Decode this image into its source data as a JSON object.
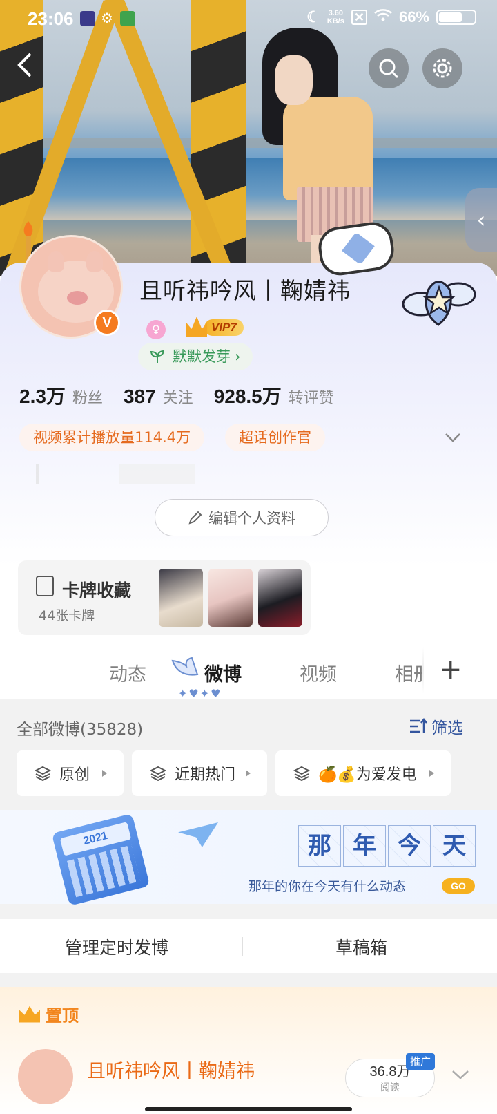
{
  "status_bar": {
    "time": "23:06",
    "net_speed_value": "3.60",
    "net_speed_unit": "KB/s",
    "battery": "66%",
    "battery_level_pct": 66
  },
  "nav": {
    "back_icon": "chevron-left-icon",
    "search_icon": "search-icon",
    "settings_icon": "gear-icon"
  },
  "profile": {
    "username": "且听祎吟风丨鞠婧祎",
    "vip_label": "VIP7",
    "verified_mark": "V",
    "sprout_label": "默默发芽",
    "sprout_arrow": "›",
    "stats": [
      {
        "value": "2.3万",
        "label": "粉丝"
      },
      {
        "value": "387",
        "label": "关注"
      },
      {
        "value": "928.5万",
        "label": "转评赞"
      }
    ],
    "tags": [
      "视频累计播放量114.4万",
      "超话创作官"
    ],
    "edit_button": "编辑个人资料"
  },
  "card_collection": {
    "title": "卡牌收藏",
    "count": "44张卡牌"
  },
  "tabs": {
    "items": [
      "动态",
      "微博",
      "视频",
      "相册"
    ],
    "active": "微博",
    "active_deco": "✦♥✦♥",
    "add": "+"
  },
  "feed": {
    "all_count": "全部微博(35828)",
    "filter_label": "筛选",
    "chips": [
      "原创",
      "近期热门",
      "🍊💰为爱发电"
    ],
    "on_this_day": {
      "chars": [
        "那",
        "年",
        "今",
        "天"
      ],
      "subtitle": "那年的你在今天有什么动态",
      "go": "GO",
      "calendar_year": "2021"
    },
    "manage_scheduled": "管理定时发博",
    "drafts": "草稿箱",
    "pinned_label": "置顶",
    "pinned_post": {
      "author": "且听祎吟风丨鞠婧祎",
      "reads_value": "36.8万",
      "reads_label": "阅读",
      "promo": "推广"
    }
  },
  "colors": {
    "accent_orange": "#ea6a16",
    "link_blue": "#33559e",
    "sprout_green": "#3a9a5b"
  }
}
